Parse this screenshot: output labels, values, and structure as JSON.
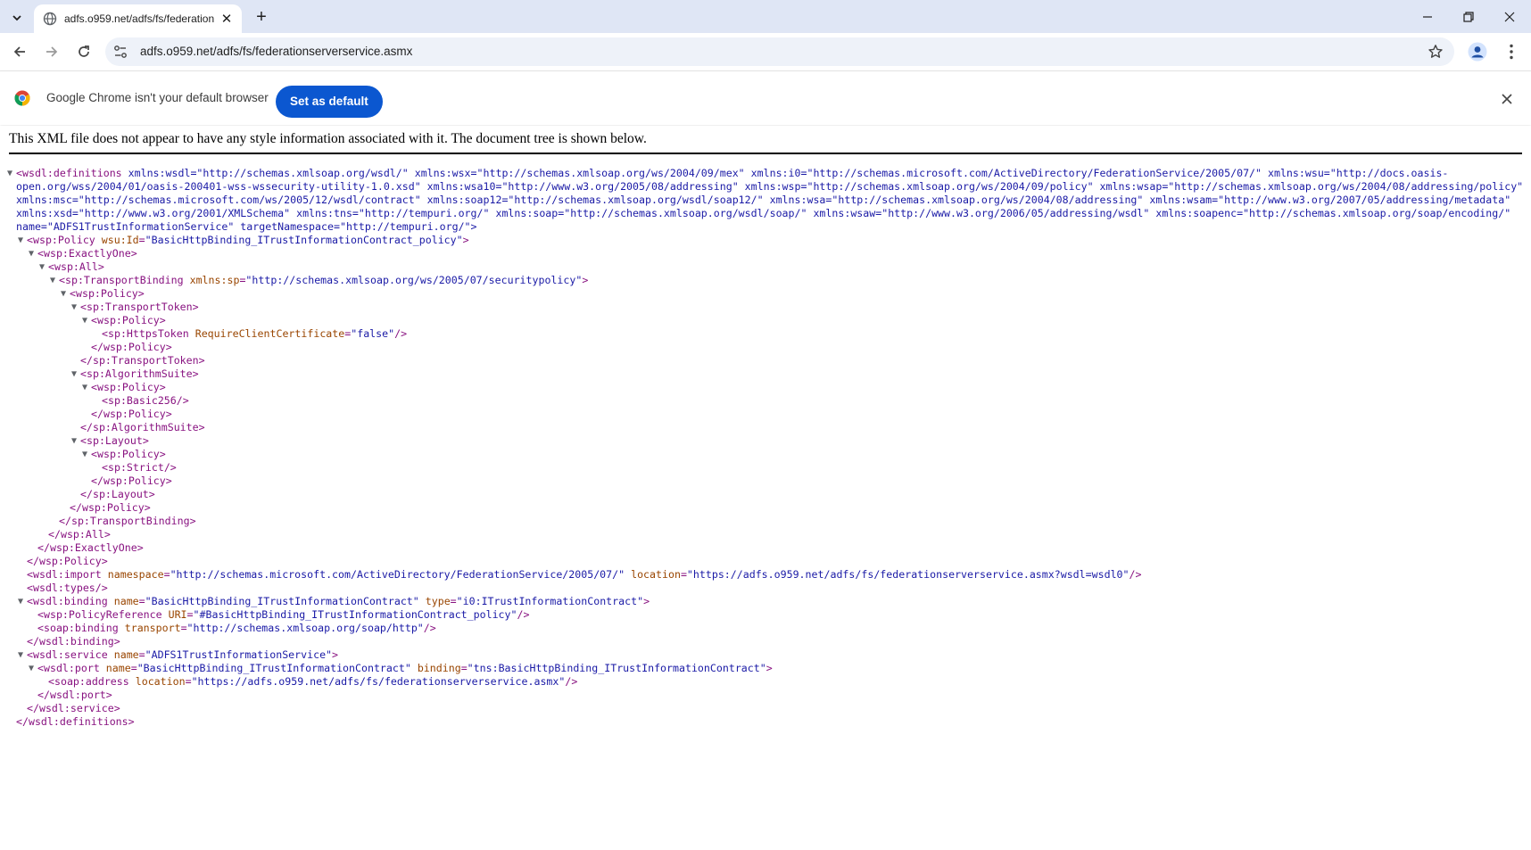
{
  "tab": {
    "title": "adfs.o959.net/adfs/fs/federation",
    "close_icon": "close-icon"
  },
  "toolbar": {
    "url": "adfs.o959.net/adfs/fs/federationserverservice.asmx"
  },
  "infobar": {
    "message": "Google Chrome isn't your default browser",
    "button": "Set as default"
  },
  "content": {
    "notice": "This XML file does not appear to have any style information associated with it. The document tree is shown below."
  },
  "xml": {
    "definitions_attrs": "xmlns:wsdl=\"http://schemas.xmlsoap.org/wsdl/\" xmlns:wsx=\"http://schemas.xmlsoap.org/ws/2004/09/mex\" xmlns:i0=\"http://schemas.microsoft.com/ActiveDirectory/FederationService/2005/07/\" xmlns:wsu=\"http://docs.oasis-open.org/wss/2004/01/oasis-200401-wss-wssecurity-utility-1.0.xsd\" xmlns:wsa10=\"http://www.w3.org/2005/08/addressing\" xmlns:wsp=\"http://schemas.xmlsoap.org/ws/2004/09/policy\" xmlns:wsap=\"http://schemas.xmlsoap.org/ws/2004/08/addressing/policy\" xmlns:msc=\"http://schemas.microsoft.com/ws/2005/12/wsdl/contract\" xmlns:soap12=\"http://schemas.xmlsoap.org/wsdl/soap12/\" xmlns:wsa=\"http://schemas.xmlsoap.org/ws/2004/08/addressing\" xmlns:wsam=\"http://www.w3.org/2007/05/addressing/metadata\" xmlns:xsd=\"http://www.w3.org/2001/XMLSchema\" xmlns:tns=\"http://tempuri.org/\" xmlns:soap=\"http://schemas.xmlsoap.org/wsdl/soap/\" xmlns:wsaw=\"http://www.w3.org/2006/05/addressing/wsdl\" xmlns:soapenc=\"http://schemas.xmlsoap.org/soap/encoding/\" name=\"ADFS1TrustInformationService\" targetNamespace=\"http://tempuri.org/\">",
    "lines": [
      "<wsp:Policy wsu:Id=\"BasicHttpBinding_ITrustInformationContract_policy\">",
      "<wsp:ExactlyOne>",
      "<wsp:All>",
      "<sp:TransportBinding xmlns:sp=\"http://schemas.xmlsoap.org/ws/2005/07/securitypolicy\">",
      "<wsp:Policy>",
      "<sp:TransportToken>",
      "<wsp:Policy>",
      "<sp:HttpsToken RequireClientCertificate=\"false\"/>",
      "</wsp:Policy>",
      "</sp:TransportToken>",
      "<sp:AlgorithmSuite>",
      "<wsp:Policy>",
      "<sp:Basic256/>",
      "</wsp:Policy>",
      "</sp:AlgorithmSuite>",
      "<sp:Layout>",
      "<wsp:Policy>",
      "<sp:Strict/>",
      "</wsp:Policy>",
      "</sp:Layout>",
      "</wsp:Policy>",
      "</sp:TransportBinding>",
      "</wsp:All>",
      "</wsp:ExactlyOne>",
      "</wsp:Policy>",
      "<wsdl:import namespace=\"http://schemas.microsoft.com/ActiveDirectory/FederationService/2005/07/\" location=\"https://adfs.o959.net/adfs/fs/federationserverservice.asmx?wsdl=wsdl0\"/>",
      "<wsdl:types/>",
      "<wsdl:binding name=\"BasicHttpBinding_ITrustInformationContract\" type=\"i0:ITrustInformationContract\">",
      "<wsp:PolicyReference URI=\"#BasicHttpBinding_ITrustInformationContract_policy\"/>",
      "<soap:binding transport=\"http://schemas.xmlsoap.org/soap/http\"/>",
      "</wsdl:binding>",
      "<wsdl:service name=\"ADFS1TrustInformationService\">",
      "<wsdl:port name=\"BasicHttpBinding_ITrustInformationContract\" binding=\"tns:BasicHttpBinding_ITrustInformationContract\">",
      "<soap:address location=\"https://adfs.o959.net/adfs/fs/federationserverservice.asmx\"/>",
      "</wsdl:port>",
      "</wsdl:service>",
      "</wsdl:definitions>"
    ]
  }
}
